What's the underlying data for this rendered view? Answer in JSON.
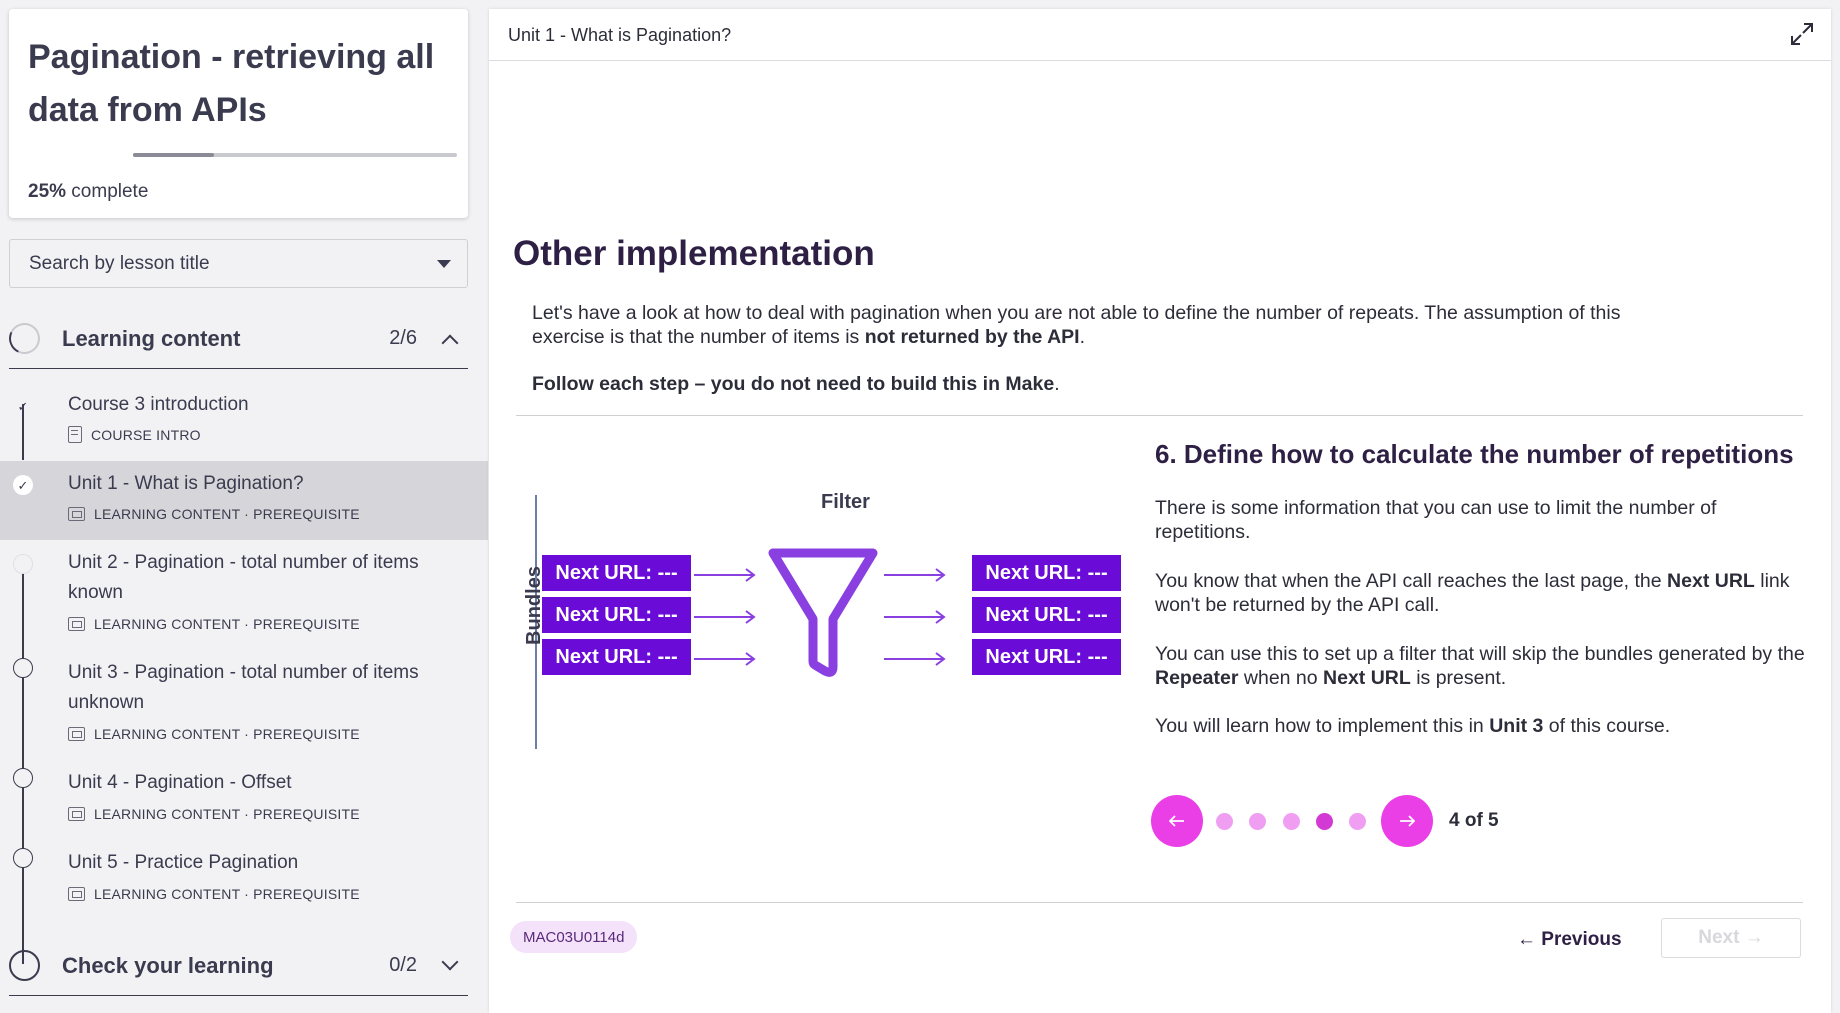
{
  "sidebar": {
    "course_title": "Pagination - retrieving all data from APIs",
    "progress_percent_text": "25%",
    "progress_suffix": " complete",
    "progress_value": 0.25,
    "search_placeholder": "Search by lesson title",
    "sections": [
      {
        "title": "Learning content",
        "count": "2/6",
        "expanded": true
      },
      {
        "title": "Check your learning",
        "count": "0/2",
        "expanded": false
      }
    ],
    "lessons": [
      {
        "name": "Course 3 introduction",
        "meta": "COURSE INTRO",
        "completed": true,
        "active": false
      },
      {
        "name": "Unit 1 - What is Pagination?",
        "meta": "LEARNING CONTENT · PREREQUISITE",
        "completed": true,
        "active": true
      },
      {
        "name": "Unit 2 - Pagination - total number of items known",
        "meta": "LEARNING CONTENT · PREREQUISITE",
        "completed": false,
        "active": false
      },
      {
        "name": "Unit 3 - Pagination - total number of items unknown",
        "meta": "LEARNING CONTENT · PREREQUISITE",
        "completed": false,
        "active": false
      },
      {
        "name": "Unit 4 - Pagination - Offset",
        "meta": "LEARNING CONTENT · PREREQUISITE",
        "completed": false,
        "active": false
      },
      {
        "name": "Unit 5 - Practice Pagination",
        "meta": "LEARNING CONTENT · PREREQUISITE",
        "completed": false,
        "active": false
      }
    ]
  },
  "main": {
    "unit_title": "Unit 1 - What is Pagination?",
    "heading": "Other implementation",
    "intro_text": "Let's have a look at how to deal with pagination when you are not able to define the number of repeats. The assumption of this exercise is that the number of items is ",
    "intro_bold": "not returned by the API",
    "intro_end": ".",
    "instruction_bold": "Follow each step – you do not need to build this in Make",
    "instruction_end": ".",
    "diagram": {
      "bundles_label": "Bundles",
      "filter_label": "Filter",
      "box_label": "Next URL: ---"
    },
    "step": {
      "title": "6. Define how to calculate the number of repetitions",
      "p1": "There is some information that you can use to limit the number of repetitions.",
      "p2_a": "You know that when the API call reaches the last page, the ",
      "p2_b": "Next URL",
      "p2_c": " link won't be returned by the API call.",
      "p3_a": "You can use this to set up a filter that will skip the bundles generated by the ",
      "p3_b": "Repeater",
      "p3_c": " when no ",
      "p3_d": "Next URL",
      "p3_e": " is present.",
      "p4_a": "You will learn how to implement this in ",
      "p4_b": "Unit 3",
      "p4_c": " of this course."
    },
    "carousel": {
      "current": 4,
      "total": 5,
      "counter_text": "4 of 5",
      "prev_icon": "arrow-left-icon",
      "next_icon": "arrow-right-icon"
    },
    "lesson_code": "MAC03U0114d",
    "prev_label": "← Previous",
    "next_label": "Next →"
  },
  "colors": {
    "accent_pink": "#ea3fe6",
    "box_purple": "#6a0bd7",
    "arrow_purple": "#8a3fe0",
    "heading": "#2e1f44"
  }
}
